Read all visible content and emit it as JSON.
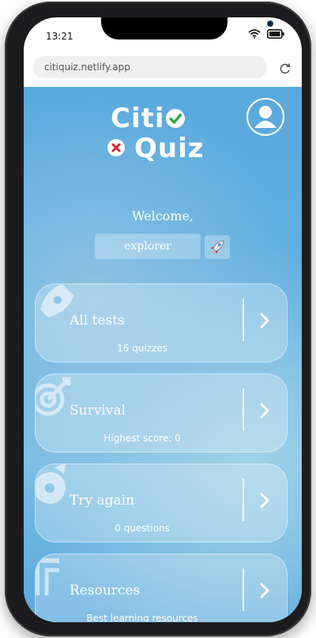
{
  "status_bar": {
    "time": "13:21"
  },
  "browser": {
    "url": "citiquiz.netlify.app"
  },
  "logo": {
    "line1": "Citi",
    "line2": "Quiz"
  },
  "welcome": {
    "greeting": "Welcome,",
    "username": "explorer"
  },
  "menu": [
    {
      "title": "All tests",
      "subtitle": "16 quizzes",
      "icon": "rocket-icon"
    },
    {
      "title": "Survival",
      "subtitle": "Highest score: 0",
      "icon": "target-icon"
    },
    {
      "title": "Try again",
      "subtitle": "0 questions",
      "icon": "retry-icon"
    },
    {
      "title": "Resources",
      "subtitle": "Best learning resources",
      "icon": "book-icon"
    }
  ],
  "colors": {
    "background": "#5aa9de",
    "check": "#2fae3b",
    "cross": "#d8232a",
    "text": "#ffffff"
  }
}
